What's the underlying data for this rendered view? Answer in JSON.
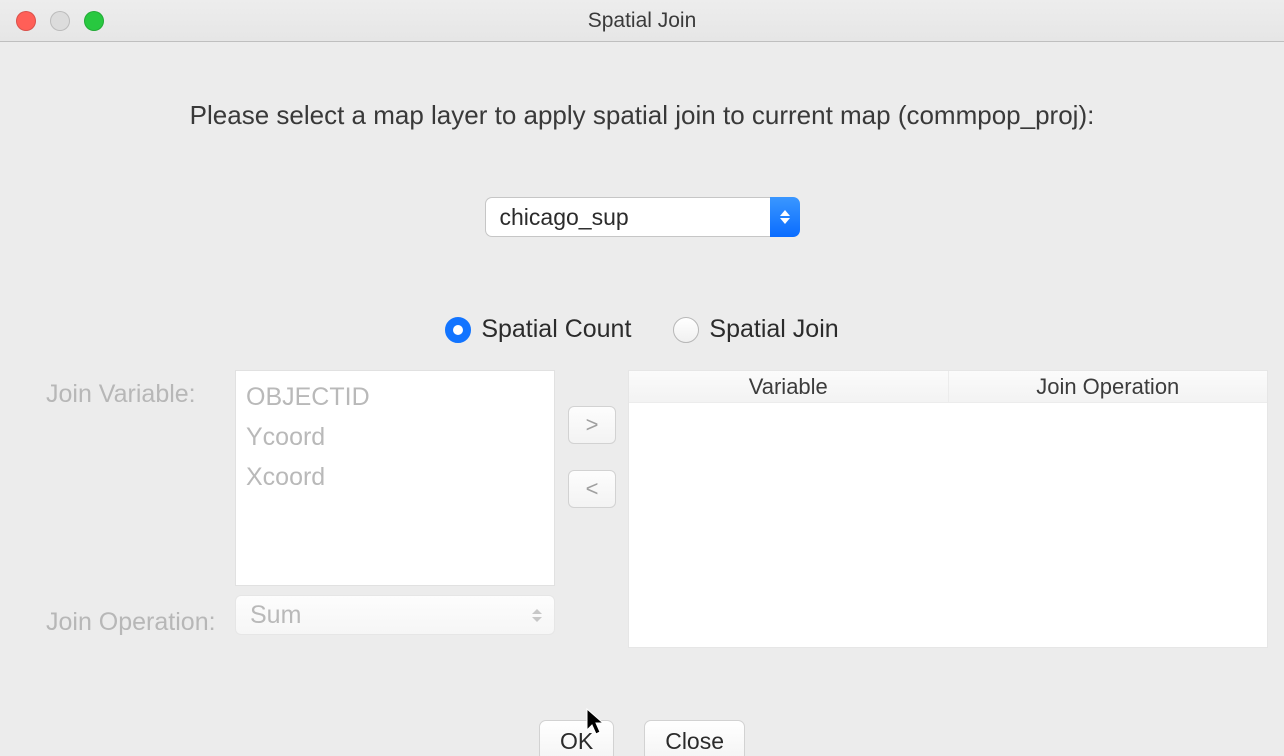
{
  "window": {
    "title": "Spatial Join"
  },
  "instruction": "Please select a map layer to apply spatial join to current map (commpop_proj):",
  "layer_select": {
    "value": "chicago_sup"
  },
  "radio": {
    "count_label": "Spatial Count",
    "join_label": "Spatial Join",
    "selected": "count"
  },
  "labels": {
    "join_variable": "Join Variable:",
    "join_operation": "Join Operation:"
  },
  "variable_list": [
    "OBJECTID",
    "Ycoord",
    "Xcoord"
  ],
  "move": {
    "add": ">",
    "remove": "<"
  },
  "operation_select": {
    "value": "Sum"
  },
  "result_columns": [
    "Variable",
    "Join Operation"
  ],
  "buttons": {
    "ok": "OK",
    "close": "Close"
  }
}
